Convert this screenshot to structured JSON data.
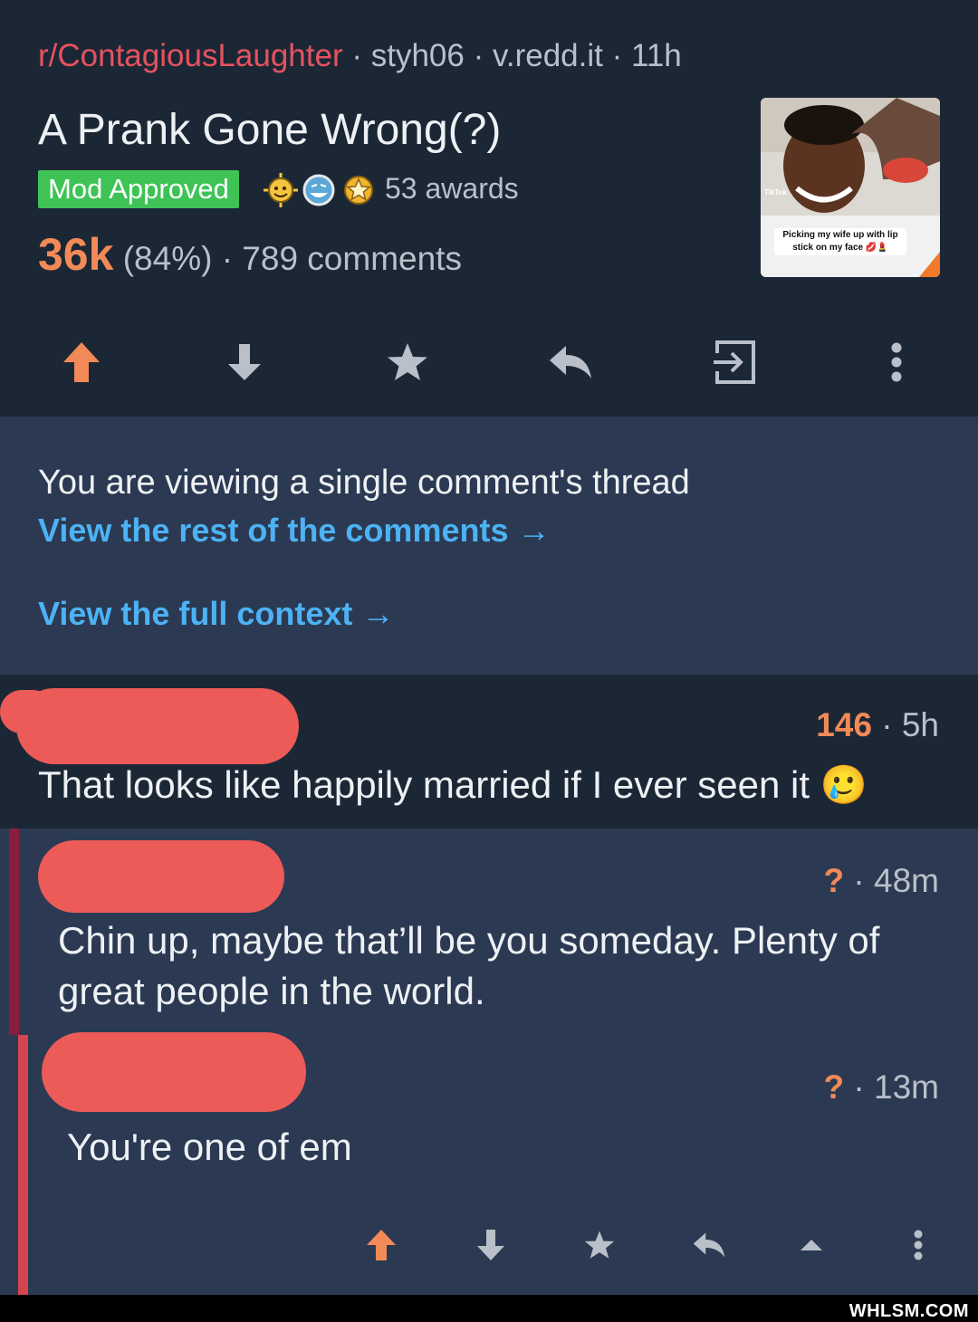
{
  "post": {
    "subreddit": "r/ContagiousLaughter",
    "meta_rest": " · styh06 · v.redd.it · 11h",
    "title": "A Prank Gone Wrong(?)",
    "flair": "Mod Approved",
    "awards": "53 awards",
    "score": "36k",
    "score_rest": " (84%) · 789 comments",
    "thumbnail_caption": "Picking my wife up with lip stick on my face 💋💄",
    "thumbnail_watermark": "TikTok"
  },
  "actions": {
    "icons": [
      "upvote-icon",
      "downvote-icon",
      "star-icon",
      "reply-icon",
      "open-external-icon",
      "more-icon"
    ]
  },
  "notice": {
    "text": "You are viewing a single comment's thread",
    "rest_link": "View the rest of the comments →",
    "context_link": "View the full context →"
  },
  "comments": [
    {
      "score": "146",
      "time": " · 5h",
      "body": "That looks like happily married if I ever seen it 🥲"
    },
    {
      "score": "?",
      "time": " · 48m",
      "body": "Chin up, maybe that’ll be you someday. Plenty of great people in the world."
    },
    {
      "score": "?",
      "time": " · 13m",
      "body": "You're one of em"
    }
  ],
  "footer": {
    "brand": "WHLSM.COM"
  },
  "colors": {
    "background": "#1c2736",
    "notice_bg": "#2b3a52",
    "accent_orange": "#f28a58",
    "subreddit_red": "#e5535f",
    "link_blue": "#4db2f4",
    "flair_green": "#3fc356"
  }
}
